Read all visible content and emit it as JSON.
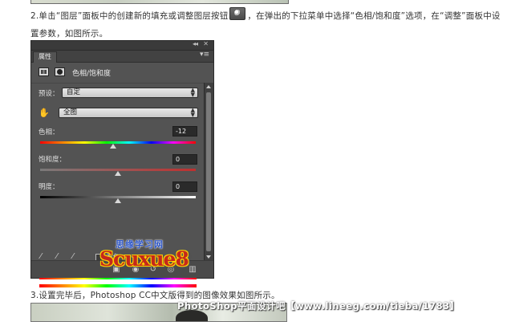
{
  "article": {
    "step2_text_a": "2.单击“图层”面板中的创建新的填充或调整图层按钮",
    "step2_text_b": "，在弹出的下拉菜单中选择“色相/饱和度”选项，在“调整”面板中设置参数，如图所示。",
    "step3_text": "3.设置完毕后，Photoshop CC中文版得到的图像效果如图所示。"
  },
  "panel": {
    "tab_label": "属性",
    "collapse_glyph": "◂◂",
    "close_glyph": "✕",
    "menu_glyph": "▾≡",
    "header_title": "色相/饱和度",
    "preset_label": "预设：",
    "preset_value": "自定",
    "range_value": "全图",
    "hue_label": "色相：",
    "hue_value": "-12",
    "saturation_label": "饱和度：",
    "saturation_value": "0",
    "lightness_label": "明度：",
    "lightness_value": "0",
    "colorize_label": "着色",
    "colorize_checked": false,
    "hue_level": -12,
    "saturation_level": 0,
    "lightness_level": 0
  },
  "watermarks": {
    "site": "思缘学习网",
    "brand": "Scuxue8",
    "credit": "PhotoShop平面设计吧【www.lineeg.com/tieba/1783】"
  },
  "icons": [
    "layer-mask-button-icon",
    "hue-saturation-icon",
    "mask-icon",
    "hand-tool-icon",
    "eyedropper-icon",
    "eyedropper-plus-icon",
    "eyedropper-minus-icon",
    "clip-to-layer-icon",
    "visibility-icon",
    "reset-icon",
    "eye-icon",
    "trash-icon"
  ]
}
